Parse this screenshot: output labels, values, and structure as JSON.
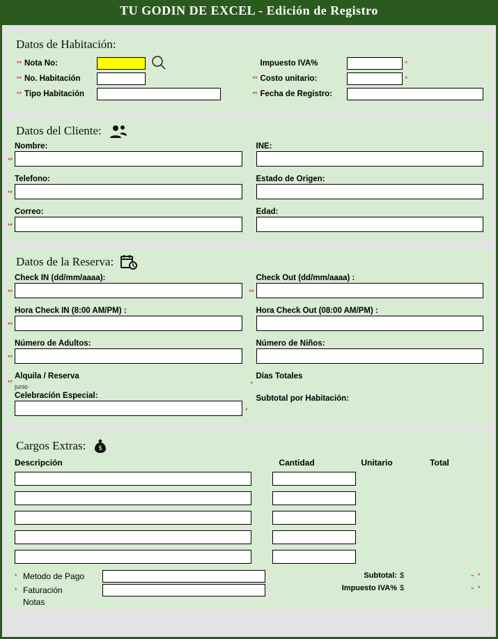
{
  "header": {
    "title": "TU GODIN DE EXCEL - Edición de Registro"
  },
  "habitacion": {
    "title": "Datos de Habitación:",
    "nota_no": {
      "label": "Nota No:",
      "value": ""
    },
    "no_hab": {
      "label": "No. Habitación",
      "value": ""
    },
    "tipo": {
      "label": "Tipo Habitación",
      "value": ""
    },
    "iva": {
      "label": "Impuesto IVA%",
      "value": ""
    },
    "costo": {
      "label": "Costo unitario:",
      "value": ""
    },
    "fecha": {
      "label": "Fecha de Registro:",
      "value": ""
    },
    "search_icon": "search-icon"
  },
  "cliente": {
    "title": "Datos del Cliente:",
    "nombre": "Nombre:",
    "ine": "INE:",
    "telefono": "Telefono:",
    "estado": "Estado de Origen:",
    "correo": "Correo:",
    "edad": "Edad:"
  },
  "reserva": {
    "title": "Datos de la Reserva:",
    "checkin": "Check IN (dd/mm/aaaa):",
    "checkout": "Check Out (dd/mm/aaaa) :",
    "hora_in": "Hora Check IN (8:00 AM/PM) :",
    "hora_out": "Hora Check Out (08:00 AM/PM) :",
    "adultos": "Número de Adultos:",
    "ninos": "Número de Niños:",
    "alquila": "Alquila / Reserva",
    "dias": "Días Totales",
    "junio_note": "junio",
    "celebracion": "Celebración Especial:",
    "subtotal_hab": "Subtotal por Habitación:"
  },
  "extras": {
    "title": "Cargos Extras:",
    "headers": {
      "desc": "Descripción",
      "cant": "Cantidad",
      "unit": "Unitario",
      "total": "Total"
    },
    "rows": [
      {
        "desc": "",
        "cant": ""
      },
      {
        "desc": "",
        "cant": ""
      },
      {
        "desc": "",
        "cant": ""
      },
      {
        "desc": "",
        "cant": ""
      },
      {
        "desc": "",
        "cant": ""
      }
    ]
  },
  "pago": {
    "metodo": "Metodo de Pago",
    "facturacion": "Faturación",
    "notas": "Notas",
    "subtotal": {
      "label": "Subtotal:",
      "cur": "$",
      "value": "-"
    },
    "iva": {
      "label": "Impuesto IVA%",
      "cur": "$",
      "value": "-"
    }
  }
}
